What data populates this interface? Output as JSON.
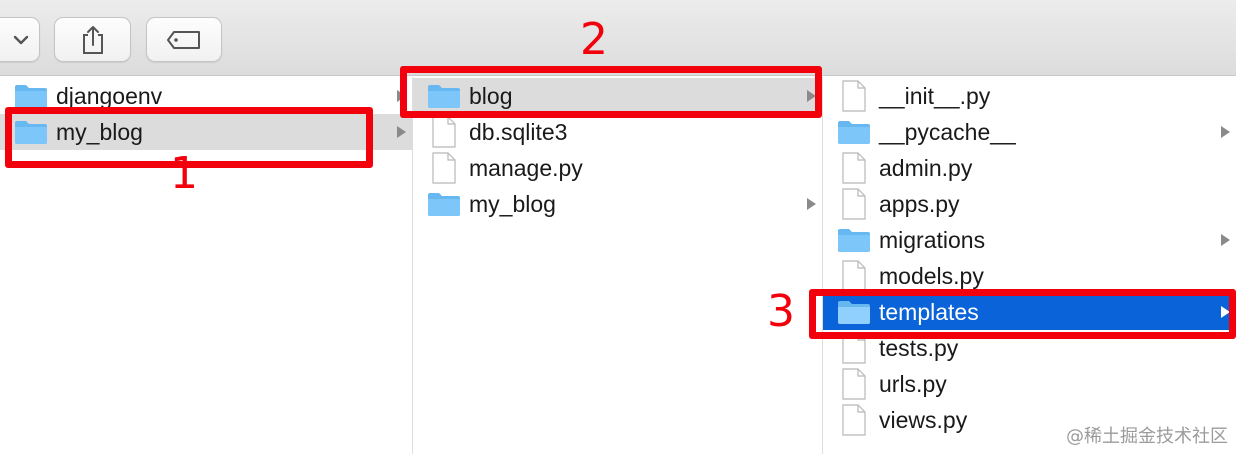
{
  "toolbar": {
    "buttons": [
      {
        "name": "view-options-button",
        "icon": "chevron-down-icon"
      },
      {
        "name": "share-button",
        "icon": "share-icon"
      },
      {
        "name": "tag-button",
        "icon": "tag-icon"
      }
    ]
  },
  "columns": [
    {
      "items": [
        {
          "label": "djangoenv",
          "type": "folder",
          "has_children": true,
          "state": "normal"
        },
        {
          "label": "my_blog",
          "type": "folder",
          "has_children": true,
          "state": "selected-inactive"
        }
      ]
    },
    {
      "items": [
        {
          "label": "blog",
          "type": "folder",
          "has_children": true,
          "state": "selected-inactive"
        },
        {
          "label": "db.sqlite3",
          "type": "file",
          "has_children": false,
          "state": "normal"
        },
        {
          "label": "manage.py",
          "type": "file",
          "has_children": false,
          "state": "normal"
        },
        {
          "label": "my_blog",
          "type": "folder",
          "has_children": true,
          "state": "normal"
        }
      ]
    },
    {
      "items": [
        {
          "label": "__init__.py",
          "type": "file",
          "has_children": false,
          "state": "normal"
        },
        {
          "label": "__pycache__",
          "type": "folder",
          "has_children": true,
          "state": "normal"
        },
        {
          "label": "admin.py",
          "type": "file",
          "has_children": false,
          "state": "normal"
        },
        {
          "label": "apps.py",
          "type": "file",
          "has_children": false,
          "state": "normal"
        },
        {
          "label": "migrations",
          "type": "folder",
          "has_children": true,
          "state": "normal"
        },
        {
          "label": "models.py",
          "type": "file",
          "has_children": false,
          "state": "normal"
        },
        {
          "label": "templates",
          "type": "folder",
          "has_children": true,
          "state": "selected-active"
        },
        {
          "label": "tests.py",
          "type": "file",
          "has_children": false,
          "state": "normal"
        },
        {
          "label": "urls.py",
          "type": "file",
          "has_children": false,
          "state": "normal"
        },
        {
          "label": "views.py",
          "type": "file",
          "has_children": false,
          "state": "normal"
        }
      ]
    }
  ],
  "annotations": [
    {
      "label": "1"
    },
    {
      "label": "2"
    },
    {
      "label": "3"
    }
  ],
  "watermark": "@稀土掘金技术社区",
  "colors": {
    "annotation": "#f2000c",
    "selection_active": "#0a63d9",
    "selection_inactive": "#dcdcdc",
    "folder": "#67b7f0"
  }
}
